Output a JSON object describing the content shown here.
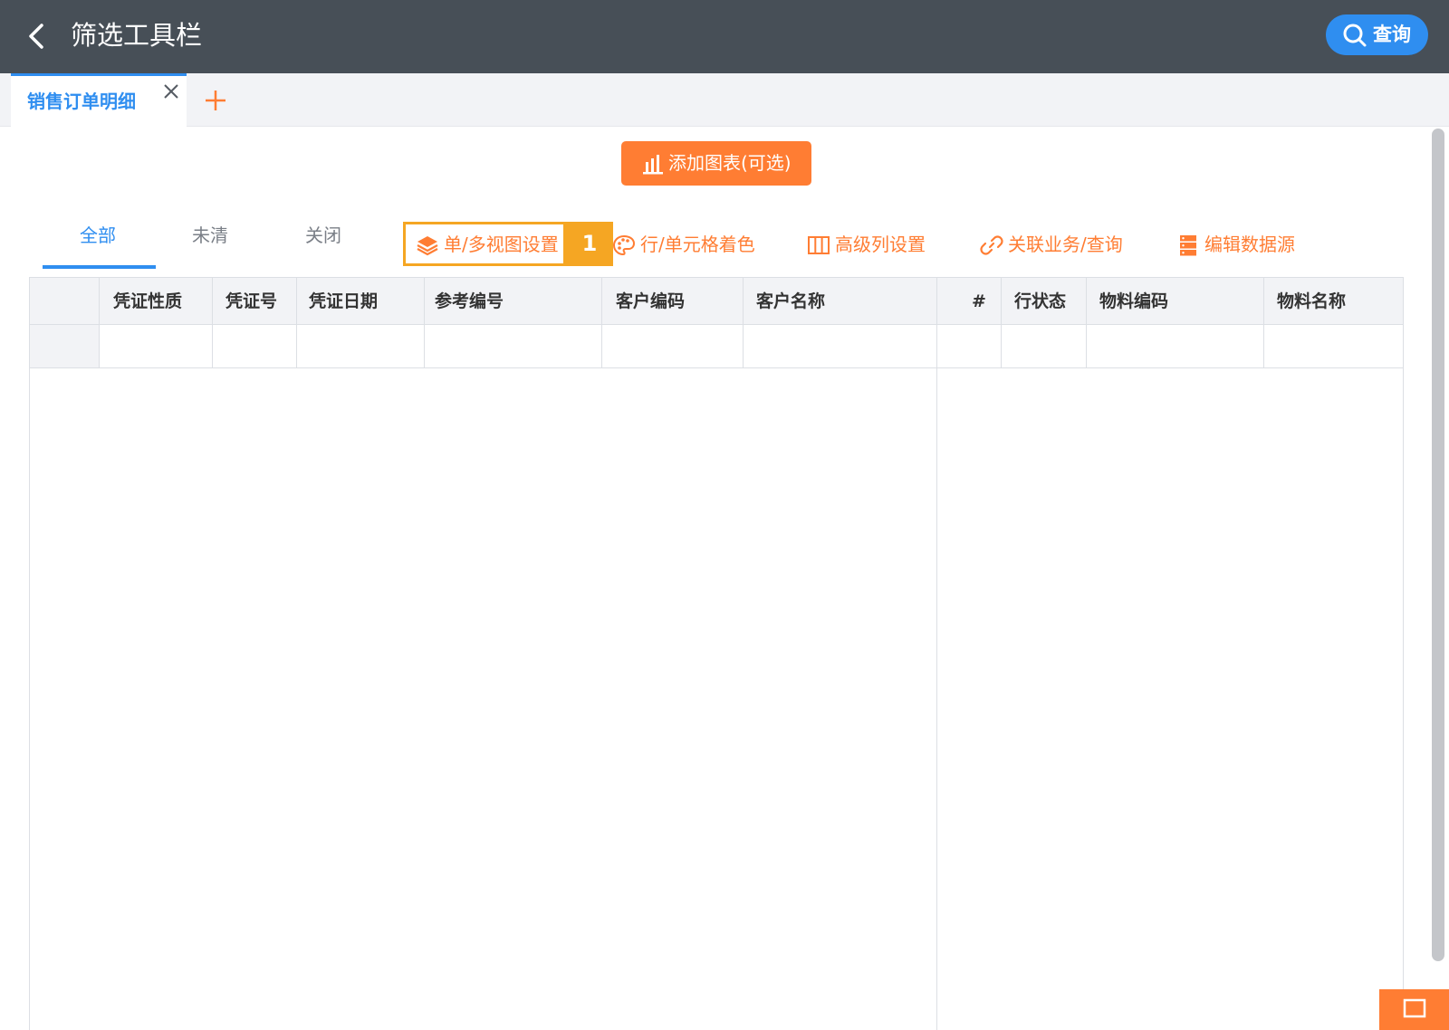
{
  "header": {
    "title": "筛选工具栏",
    "query_label": "查询"
  },
  "tabs": {
    "active_tab_label": "销售订单明细"
  },
  "add_chart_label": "添加图表(可选)",
  "filter_tabs": [
    "全部",
    "未清",
    "关闭"
  ],
  "active_filter_tab": "全部",
  "toolbar": [
    {
      "label": "单/多视图设置",
      "icon": "layers-icon"
    },
    {
      "label": "行/单元格着色",
      "icon": "palette-icon"
    },
    {
      "label": "高级列设置",
      "icon": "columns-icon"
    },
    {
      "label": "关联业务/查询",
      "icon": "link-icon"
    },
    {
      "label": "编辑数据源",
      "icon": "database-icon"
    }
  ],
  "step_badge": "1",
  "grid": {
    "columns": [
      "凭证性质",
      "凭证号",
      "凭证日期",
      "参考编号",
      "客户编码",
      "客户名称",
      "#",
      "行状态",
      "物料编码",
      "物料名称"
    ]
  },
  "colors": {
    "header_bg": "#474f57",
    "accent_blue": "#2f8ef0",
    "accent_orange": "#ff7d33",
    "highlight": "#f5a623"
  }
}
